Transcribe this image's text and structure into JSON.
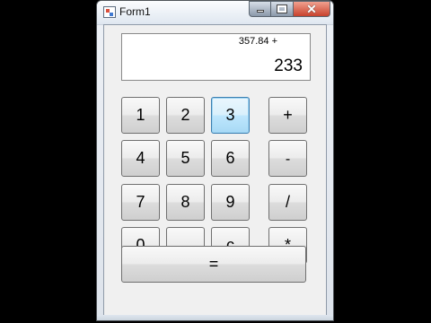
{
  "window": {
    "title": "Form1",
    "icon": "app-icon",
    "title_buttons": {
      "minimize_icon": "minimize-icon",
      "maximize_icon": "maximize-icon",
      "close_label": "✕"
    }
  },
  "display": {
    "expression": "357.84 +",
    "result": "233"
  },
  "keys": {
    "row1": [
      "1",
      "2",
      "3",
      "+"
    ],
    "row2": [
      "4",
      "5",
      "6",
      "-"
    ],
    "row3": [
      "7",
      "8",
      "9",
      "/"
    ],
    "row4": [
      "0",
      ".",
      "c",
      "*"
    ],
    "equals": "="
  },
  "colors": {
    "focus_border": "#3c7fb1",
    "close_button": "#c7412c"
  }
}
